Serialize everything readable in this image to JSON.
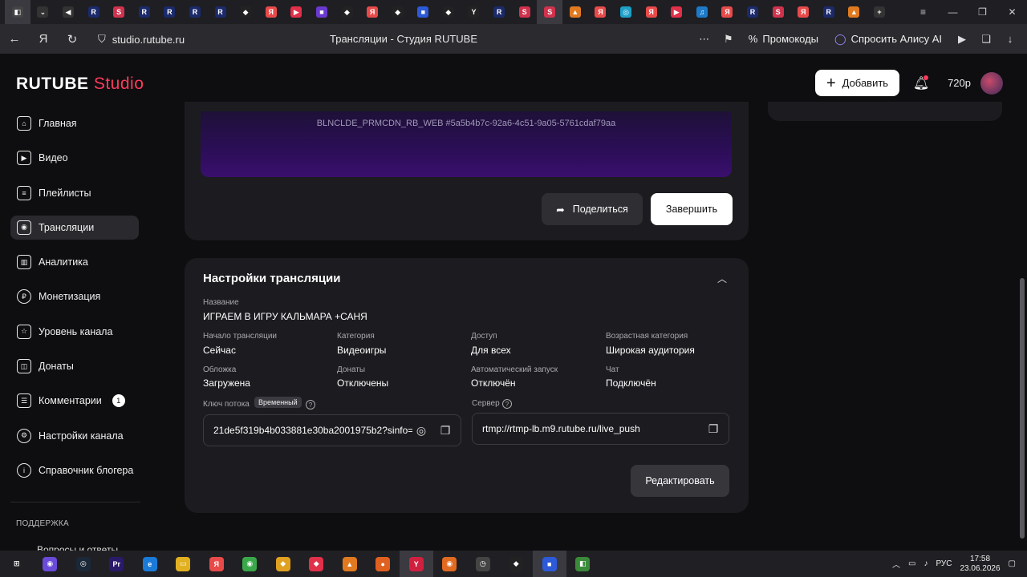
{
  "browser": {
    "tabs": [
      {
        "glyph": "◧",
        "color": "#444",
        "active": true
      },
      {
        "glyph": "⌄",
        "color": "#333"
      },
      {
        "glyph": "◀",
        "color": "#333"
      },
      {
        "glyph": "R",
        "color": "#1b2a6b"
      },
      {
        "glyph": "S",
        "color": "#d0324d"
      },
      {
        "glyph": "R",
        "color": "#1b2a6b"
      },
      {
        "glyph": "R",
        "color": "#1b2a6b"
      },
      {
        "glyph": "R",
        "color": "#1b2a6b"
      },
      {
        "glyph": "R",
        "color": "#1b2a6b"
      },
      {
        "glyph": "◆",
        "color": "#222"
      },
      {
        "glyph": "Я",
        "color": "#e84a4a"
      },
      {
        "glyph": "▶",
        "color": "#e0304a"
      },
      {
        "glyph": "■",
        "color": "#6a3ad0"
      },
      {
        "glyph": "◆",
        "color": "#222"
      },
      {
        "glyph": "Я",
        "color": "#e84a4a"
      },
      {
        "glyph": "◆",
        "color": "#222"
      },
      {
        "glyph": "■",
        "color": "#2c5ad8"
      },
      {
        "glyph": "◆",
        "color": "#222"
      },
      {
        "glyph": "Y",
        "color": "#222"
      },
      {
        "glyph": "R",
        "color": "#1b2a6b"
      },
      {
        "glyph": "S",
        "color": "#d0324d"
      },
      {
        "glyph": "S",
        "color": "#d0324d",
        "active": true
      },
      {
        "glyph": "▲",
        "color": "#e07a20"
      },
      {
        "glyph": "Я",
        "color": "#e84a4a"
      },
      {
        "glyph": "◎",
        "color": "#1da0c8"
      },
      {
        "glyph": "Я",
        "color": "#e84a4a"
      },
      {
        "glyph": "▶",
        "color": "#e0304a"
      },
      {
        "glyph": "♫",
        "color": "#1d7ac8"
      },
      {
        "glyph": "Я",
        "color": "#e84a4a"
      },
      {
        "glyph": "R",
        "color": "#1b2a6b"
      },
      {
        "glyph": "S",
        "color": "#d0324d"
      },
      {
        "glyph": "Я",
        "color": "#e84a4a"
      },
      {
        "glyph": "R",
        "color": "#1b2a6b"
      },
      {
        "glyph": "▲",
        "color": "#e07a20"
      },
      {
        "glyph": "+",
        "color": "#333"
      }
    ],
    "url": "studio.rutube.ru",
    "page_title": "Трансляции - Студия RUTUBE",
    "promo_label": "Промокоды",
    "alice_label": "Спросить Алису AI"
  },
  "app": {
    "logo_main": "RUTUBE",
    "logo_sub": "Studio",
    "add_label": "Добавить",
    "quality_label": "720p"
  },
  "sidebar": {
    "items": [
      {
        "label": "Главная",
        "icon": "home-icon",
        "glyph": "⌂"
      },
      {
        "label": "Видео",
        "icon": "video-icon",
        "glyph": "▶"
      },
      {
        "label": "Плейлисты",
        "icon": "playlist-icon",
        "glyph": "≡"
      },
      {
        "label": "Трансляции",
        "icon": "broadcast-icon",
        "glyph": "◉",
        "active": true
      },
      {
        "label": "Аналитика",
        "icon": "analytics-icon",
        "glyph": "▥"
      },
      {
        "label": "Монетизация",
        "icon": "monetization-icon",
        "glyph": "₽",
        "round": true
      },
      {
        "label": "Уровень канала",
        "icon": "star-icon",
        "glyph": "☆"
      },
      {
        "label": "Донаты",
        "icon": "donate-icon",
        "glyph": "◫"
      },
      {
        "label": "Комментарии",
        "icon": "comment-icon",
        "glyph": "☰",
        "badge": "1"
      },
      {
        "label": "Настройки канала",
        "icon": "settings-icon",
        "glyph": "⚙",
        "round": true
      },
      {
        "label": "Справочник блогера",
        "icon": "info-icon",
        "glyph": "i",
        "round": true
      }
    ],
    "support_title": "ПОДДЕРЖКА",
    "support_cut": "Вопросы и ответы"
  },
  "stream_card": {
    "preview_text": "BLNCLDE_PRMCDN_RB_WEB #5a5b4b7c-92a6-4c51-9a05-5761cdaf79aa",
    "share_label": "Поделиться",
    "finish_label": "Завершить"
  },
  "settings": {
    "title": "Настройки трансляции",
    "name_label": "Название",
    "name_value": "ИГРАЕМ В ИГРУ КАЛЬМАРА +САНЯ",
    "start_label": "Начало трансляции",
    "start_value": "Сейчас",
    "category_label": "Категория",
    "category_value": "Видеоигры",
    "access_label": "Доступ",
    "access_value": "Для всех",
    "age_label": "Возрастная категория",
    "age_value": "Широкая аудитория",
    "cover_label": "Обложка",
    "cover_value": "Загружена",
    "donates_label": "Донаты",
    "donates_value": "Отключены",
    "autostart_label": "Автоматический запуск",
    "autostart_value": "Отключён",
    "chat_label": "Чат",
    "chat_value": "Подключён",
    "key_label": "Ключ потока",
    "key_badge": "Временный",
    "key_value": "21de5f319b4b033881e30ba2001975b2?sinfo=",
    "server_label": "Сервер",
    "server_value": "rtmp://rtmp-lb.m9.rutube.ru/live_push",
    "edit_label": "Редактировать"
  },
  "taskbar": {
    "apps": [
      {
        "glyph": "⊞",
        "color": "#202024"
      },
      {
        "glyph": "◉",
        "color": "#6a4ad8"
      },
      {
        "glyph": "◎",
        "color": "#1b2838"
      },
      {
        "glyph": "Pr",
        "color": "#2a1a6a"
      },
      {
        "glyph": "e",
        "color": "#1a7ad8"
      },
      {
        "glyph": "▭",
        "color": "#e0b020"
      },
      {
        "glyph": "Я",
        "color": "#e84a4a"
      },
      {
        "glyph": "◉",
        "color": "#3aa84a"
      },
      {
        "glyph": "◆",
        "color": "#e0a020"
      },
      {
        "glyph": "◆",
        "color": "#e0304a"
      },
      {
        "glyph": "▲",
        "color": "#e07a20"
      },
      {
        "glyph": "●",
        "color": "#e06020"
      },
      {
        "glyph": "Y",
        "color": "#d02040",
        "active": true
      },
      {
        "glyph": "◉",
        "color": "#e06a20"
      },
      {
        "glyph": "◷",
        "color": "#444"
      },
      {
        "glyph": "◆",
        "color": "#222"
      },
      {
        "glyph": "■",
        "color": "#2c5ad8",
        "active": true
      },
      {
        "glyph": "◧",
        "color": "#3a8a3a"
      }
    ],
    "lang": "РУС",
    "time": "17:58",
    "date": "23.06.2026"
  }
}
